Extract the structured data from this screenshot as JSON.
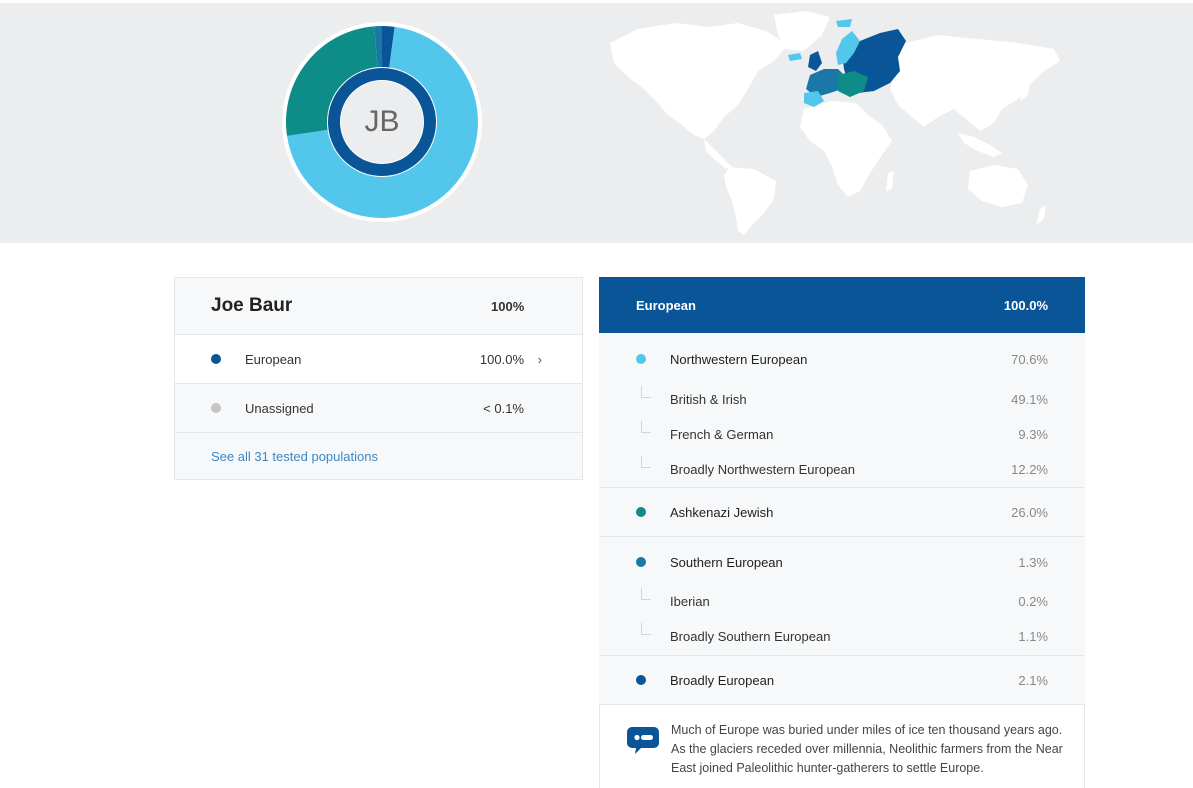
{
  "profile": {
    "initials": "JB",
    "name": "Joe Baur",
    "total": "100%"
  },
  "donut": {
    "segments": [
      {
        "name": "Northwestern European",
        "value": 70.6,
        "color": "#53c6ec"
      },
      {
        "name": "Ashkenazi Jewish",
        "value": 26.0,
        "color": "#0e8c88"
      },
      {
        "name": "Southern European",
        "value": 1.3,
        "color": "#1a77a8"
      },
      {
        "name": "Broadly European",
        "value": 2.1,
        "color": "#0a5597"
      }
    ],
    "inner_ring_color": "#0a5597"
  },
  "summary": {
    "rows": [
      {
        "label": "European",
        "value": "100.0%",
        "color": "#0a5597",
        "chevron": "›"
      },
      {
        "label": "Unassigned",
        "value": "< 0.1%",
        "color": "#c4c4c4"
      }
    ],
    "link": "See all 31 tested populations"
  },
  "detail": {
    "title": "European",
    "total": "100.0%",
    "groups": [
      {
        "label": "Northwestern European",
        "value": "70.6%",
        "color": "#53c6ec",
        "children": [
          {
            "label": "British & Irish",
            "value": "49.1%"
          },
          {
            "label": "French & German",
            "value": "9.3%"
          },
          {
            "label": "Broadly Northwestern European",
            "value": "12.2%"
          }
        ]
      },
      {
        "label": "Ashkenazi Jewish",
        "value": "26.0%",
        "color": "#0e8c88",
        "children": []
      },
      {
        "label": "Southern European",
        "value": "1.3%",
        "color": "#1a77a8",
        "children": [
          {
            "label": "Iberian",
            "value": "0.2%"
          },
          {
            "label": "Broadly Southern European",
            "value": "1.1%"
          }
        ]
      },
      {
        "label": "Broadly European",
        "value": "2.1%",
        "color": "#0a5597",
        "children": []
      }
    ],
    "note": "Much of Europe was buried under miles of ice ten thousand years ago. As the glaciers receded over millennia, Neolithic farmers from the Near East joined Paleolithic hunter-gatherers to settle Europe."
  },
  "icons": {
    "note": "chat-bubble-icon",
    "chevron": "chevron-right-icon"
  },
  "colors": {
    "hero_bg": "#ecedee",
    "header_blue": "#0a5597",
    "link_blue": "#3b87c6",
    "map_land": "#ffffff"
  }
}
